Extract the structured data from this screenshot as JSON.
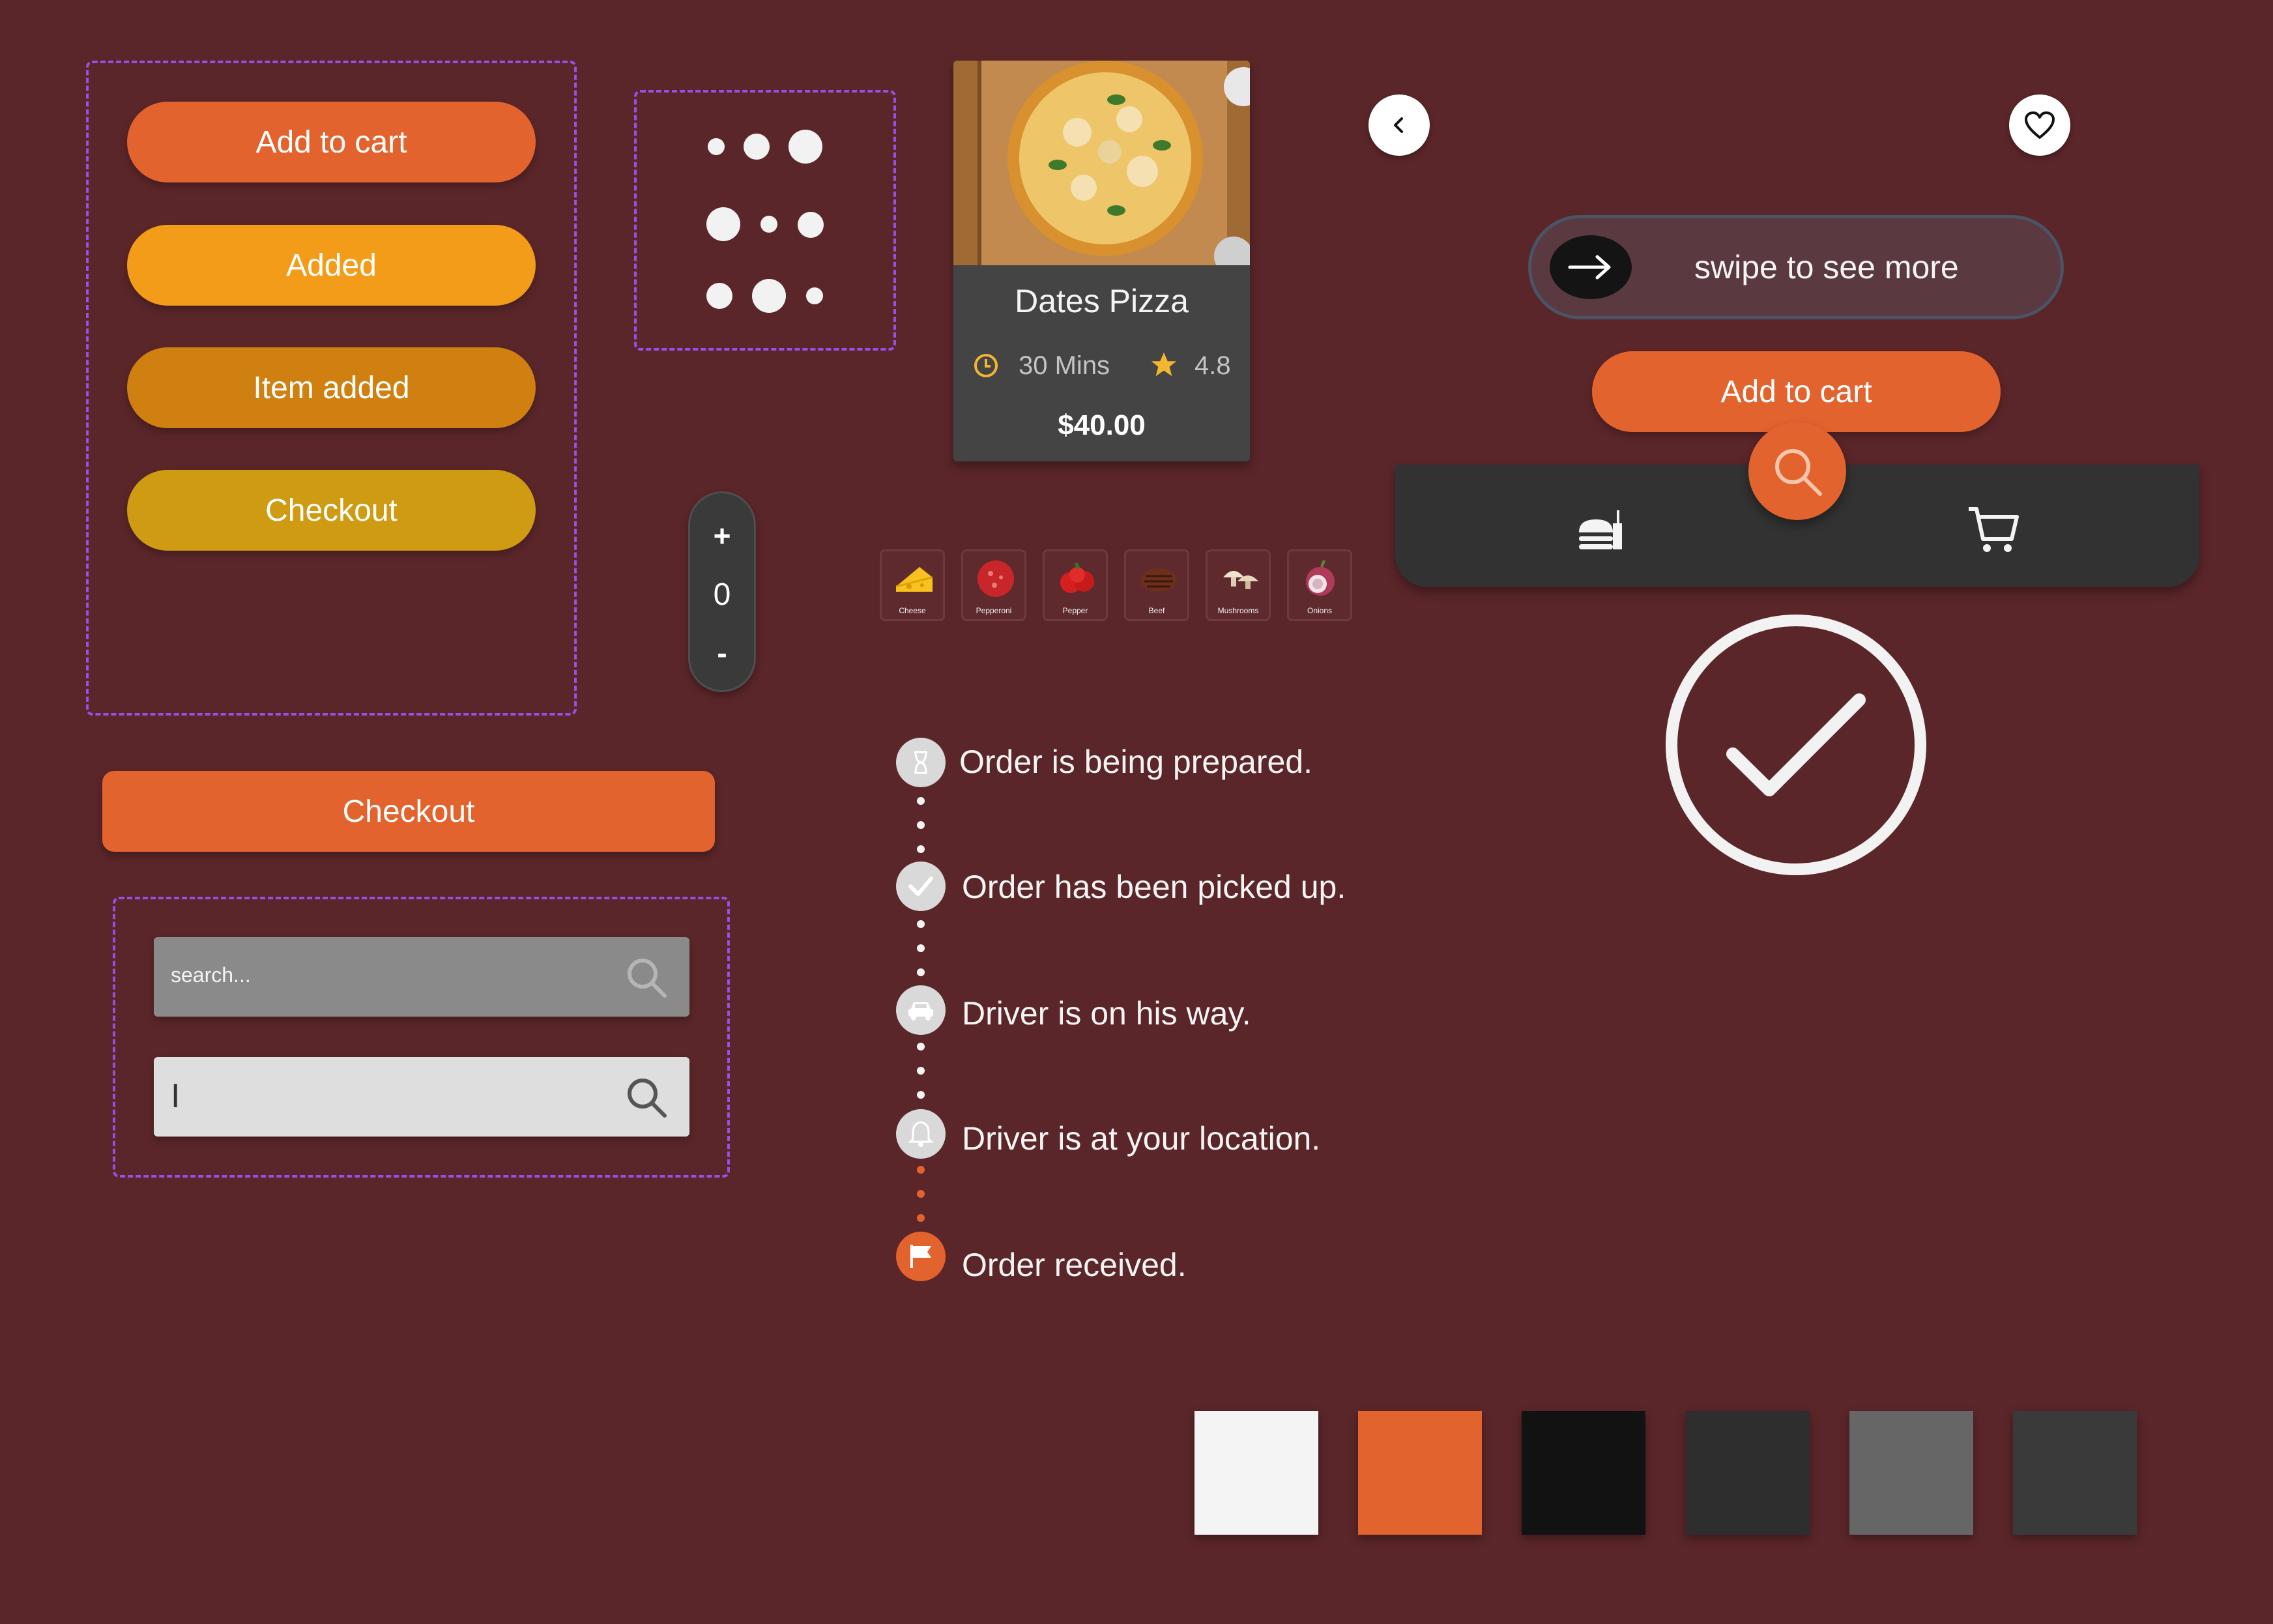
{
  "button_group": {
    "add_to_cart": "Add to cart",
    "added": "Added",
    "item_added": "Item added",
    "checkout": "Checkout"
  },
  "stepper": {
    "plus": "+",
    "value": "0",
    "minus": "-"
  },
  "food_card": {
    "name": "Dates Pizza",
    "time": "30 Mins",
    "rating": "4.8",
    "price": "$40.00"
  },
  "ingredients": [
    {
      "label": "Cheese",
      "icon": "cheese-icon"
    },
    {
      "label": "Pepperoni",
      "icon": "pepperoni-icon"
    },
    {
      "label": "Pepper",
      "icon": "pepper-icon"
    },
    {
      "label": "Beef",
      "icon": "beef-icon"
    },
    {
      "label": "Mushrooms",
      "icon": "mushroom-icon"
    },
    {
      "label": "Onions",
      "icon": "onion-icon"
    }
  ],
  "checkout_wide": {
    "label": "Checkout"
  },
  "search": {
    "placeholder": "search...",
    "active_value": "I"
  },
  "order_timeline": [
    {
      "label": "Order is being prepared.",
      "icon": "hourglass-icon"
    },
    {
      "label": "Order has been picked up.",
      "icon": "check-icon"
    },
    {
      "label": "Driver is on his way.",
      "icon": "car-icon"
    },
    {
      "label": "Driver is at your location.",
      "icon": "bell-icon"
    },
    {
      "label": "Order received.",
      "icon": "flag-icon"
    }
  ],
  "swipe": {
    "label": "swipe to see more"
  },
  "cart_button": {
    "label": "Add to cart"
  },
  "colors": {
    "background": "#5b262a",
    "orange": "#e3632e",
    "amber": "#f39c1a",
    "dark_amber": "#cf8010",
    "gold": "#cf9b13",
    "purple_dash": "#9b4de6",
    "palette": [
      "#f4f4f4",
      "#e3632e",
      "#121212",
      "#2e2e2e",
      "#666666",
      "#3a3a3a"
    ]
  }
}
